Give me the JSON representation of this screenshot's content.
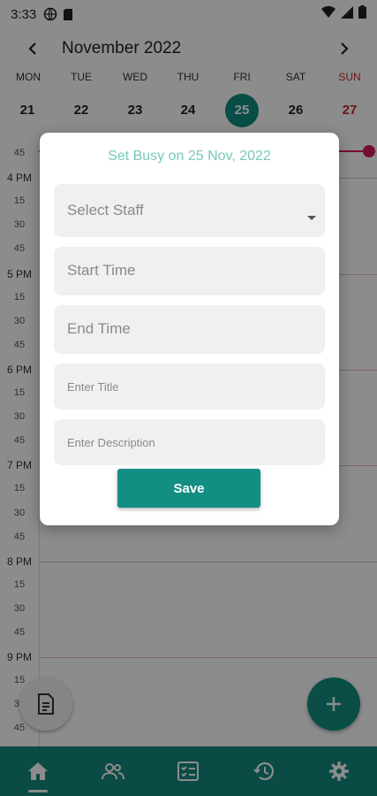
{
  "status_bar": {
    "time": "3:33"
  },
  "calendar": {
    "month_title": "November 2022",
    "weekdays": [
      "MON",
      "TUE",
      "WED",
      "THU",
      "FRI",
      "SAT",
      "SUN"
    ],
    "dates": [
      "21",
      "22",
      "23",
      "24",
      "25",
      "26",
      "27"
    ],
    "selected_date": "25",
    "colors": {
      "accent": "#0f8c80",
      "sunday": "#c62828",
      "now_line": "#d81b60"
    }
  },
  "timeline": {
    "labels": [
      "45",
      "4 PM",
      "15",
      "30",
      "45",
      "5 PM",
      "15",
      "30",
      "45",
      "6 PM",
      "15",
      "30",
      "45",
      "7 PM",
      "15",
      "30",
      "45",
      "8 PM",
      "15",
      "30",
      "45",
      "9 PM",
      "15",
      "30",
      "45"
    ]
  },
  "dialog": {
    "title": "Set Busy on 25 Nov, 2022",
    "staff_placeholder": "Select Staff",
    "start_time_placeholder": "Start Time",
    "end_time_placeholder": "End Time",
    "title_placeholder": "Enter Title",
    "description_placeholder": "Enter Description",
    "save_label": "Save"
  },
  "bottom_nav": {
    "items": [
      "home-icon",
      "people-icon",
      "checklist-icon",
      "history-icon",
      "settings-icon"
    ],
    "active": "home-icon",
    "color": "#13897e"
  }
}
